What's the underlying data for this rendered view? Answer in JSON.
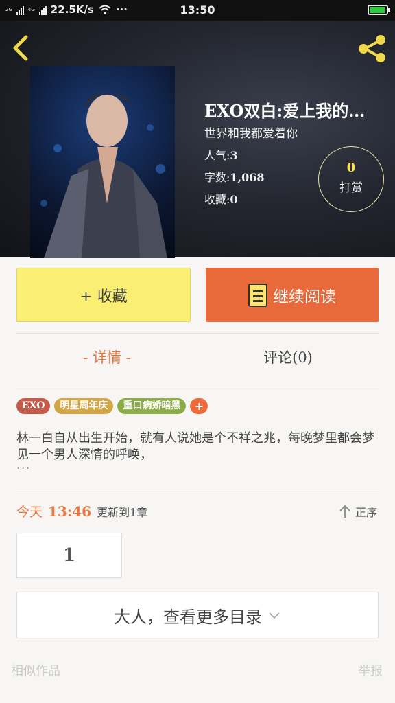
{
  "status_bar": {
    "network_speed": "22.5K/s",
    "dots": "···",
    "time": "13:50",
    "net_labels": [
      "2G",
      "4G"
    ]
  },
  "book": {
    "title": "EXO双白:爱上我的…",
    "subtitle": "世界和我都爱着你",
    "popularity_label": "人气:",
    "popularity": "3",
    "word_count_label": "字数:",
    "word_count": "1,068",
    "favorites_label": "收藏:",
    "favorites": "0",
    "tip_count": "0",
    "tip_label": "打赏"
  },
  "actions": {
    "collect_label": "+ 收藏",
    "continue_label": "继续阅读"
  },
  "tabs": [
    {
      "label": "- 详情 -"
    },
    {
      "label": "评论(0)"
    }
  ],
  "tags": [
    "EXO",
    "明星周年庆",
    "重口病娇暗黑",
    "+"
  ],
  "synopsis": "林一白自从出生开始，就有人说她是个不祥之兆，每晚梦里都会梦见一个男人深情的呼唤，",
  "synopsis_more": "···",
  "update": {
    "day": "今天",
    "time": "13:46",
    "desc": "更新到1章"
  },
  "sort_label": "正序",
  "page_number": "1",
  "catalog_label": "大人，查看更多目录",
  "footer": {
    "similar": "相似作品",
    "report": "举报"
  },
  "colors": {
    "accent_orange": "#e86a3a",
    "collect_yellow": "#fbef73",
    "tip_gold": "#ffe04a"
  }
}
